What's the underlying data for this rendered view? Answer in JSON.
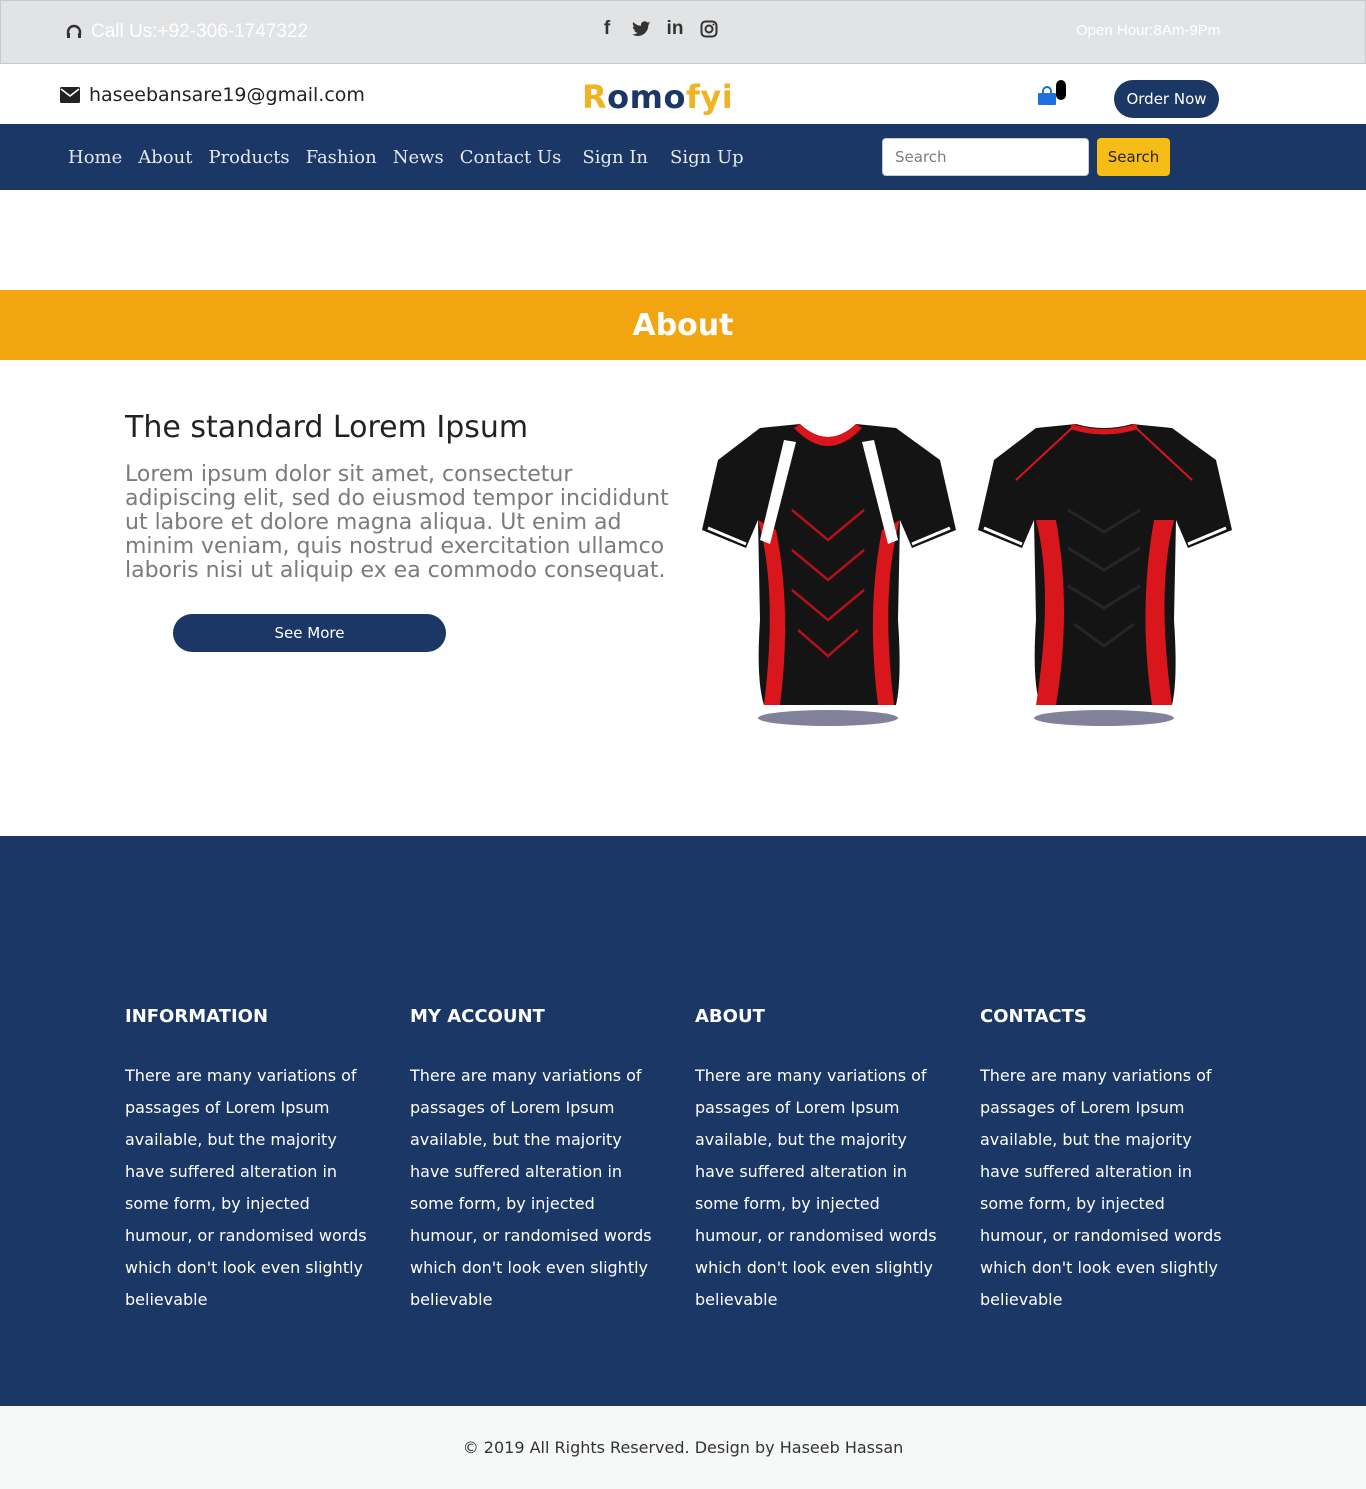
{
  "topbar": {
    "call_text": "Call Us:+92-306-1747322",
    "socials": [
      "facebook-icon",
      "twitter-icon",
      "linkedin-icon",
      "instagram-icon"
    ],
    "hours": "Open Hour:8Am-9Pm"
  },
  "header": {
    "email": "haseebansare19@gmail.com",
    "logo_part1": "Romo",
    "logo_part2": "fyi",
    "order_now": "Order Now",
    "brand_colors": {
      "navy": "#1b3766",
      "gold": "#f0b323"
    }
  },
  "nav": {
    "links": [
      "Home",
      "About",
      "Products",
      "Fashion",
      "News",
      "Contact Us",
      "Sign In",
      "Sign Up"
    ],
    "search_placeholder": "Search",
    "search_button": "Search"
  },
  "banner": {
    "title": "About",
    "color": "#f3a411"
  },
  "content": {
    "title": "The standard Lorem Ipsum",
    "text": "Lorem ipsum dolor sit amet, consectetur adipiscing elit, sed do eiusmod tempor incididunt ut labore et dolore magna aliqua. Ut enim ad minim veniam, quis nostrud exercitation ullamco laboris nisi ut aliquip ex ea commodo consequat.",
    "see_more": "See More"
  },
  "footer": {
    "columns": [
      {
        "title": "INFORMATION",
        "text": "There are many variations of passages of Lorem Ipsum available, but the majority have suffered alteration in some form, by injected humour, or randomised words which don't look even slightly believable"
      },
      {
        "title": "MY ACCOUNT",
        "text": "There are many variations of passages of Lorem Ipsum available, but the majority have suffered alteration in some form, by injected humour, or randomised words which don't look even slightly believable"
      },
      {
        "title": "ABOUT",
        "text": "There are many variations of passages of Lorem Ipsum available, but the majority have suffered alteration in some form, by injected humour, or randomised words which don't look even slightly believable"
      },
      {
        "title": "CONTACTS",
        "text": "There are many variations of passages of Lorem Ipsum available, but the majority have suffered alteration in some form, by injected humour, or randomised words which don't look even slightly believable"
      }
    ],
    "copyright": "© 2019 All Rights Reserved. Design by Haseeb Hassan"
  }
}
